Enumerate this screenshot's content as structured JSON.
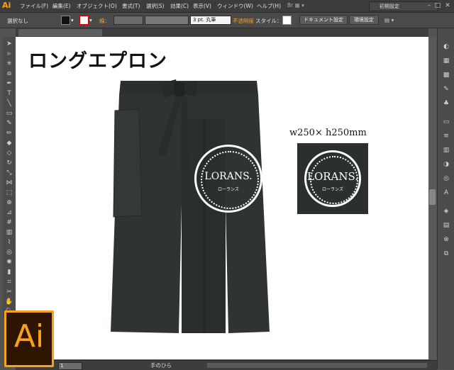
{
  "app": {
    "logo": "Ai",
    "workspace": "初期設定"
  },
  "menu": [
    "ファイル(F)",
    "編集(E)",
    "オブジェクト(O)",
    "書式(T)",
    "選択(S)",
    "効果(C)",
    "表示(V)",
    "ウィンドウ(W)",
    "ヘルプ(H)"
  ],
  "control": {
    "selection": "選択なし",
    "stroke_label": "線：",
    "stroke_weight": "3 pt. 丸筆",
    "opacity_label": "不透明度",
    "style_label": "スタイル：",
    "doc_settings": "ドキュメント設定",
    "prefs": "環境設定"
  },
  "artboard": {
    "title": "ロングエプロン",
    "dims": "w250× h250mm",
    "brand": "LORANS.",
    "brand_sub": "ローランズ"
  },
  "status": {
    "zoom": "1",
    "tool": "手のひら"
  },
  "badge": {
    "text": "Ai"
  },
  "colors": {
    "accent": "#f7a21b",
    "apron": "#2f3432",
    "logo_bg": "#2b302e"
  }
}
